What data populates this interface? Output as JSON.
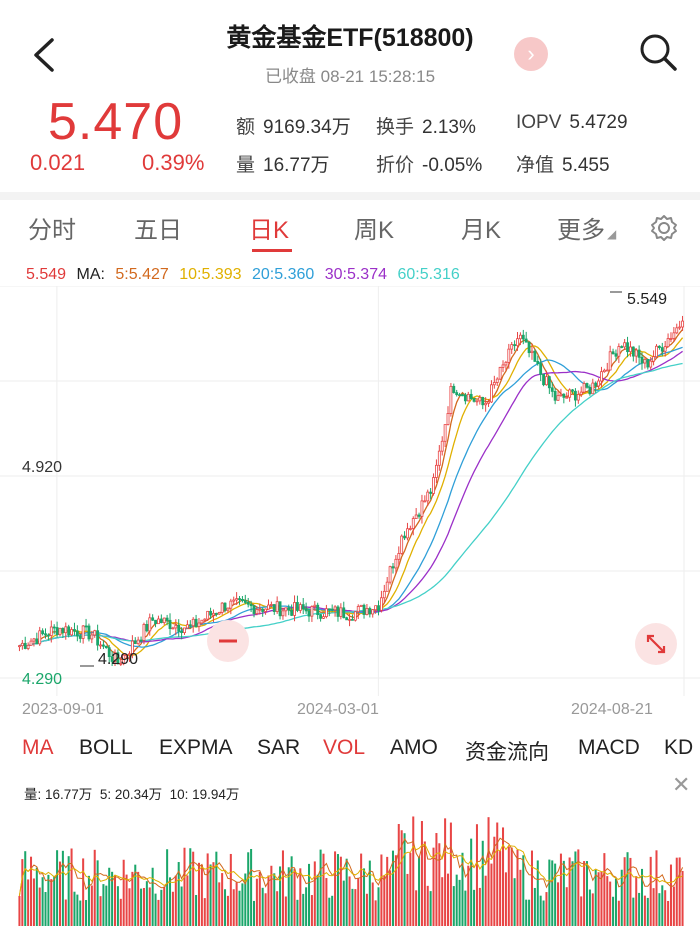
{
  "header": {
    "title": "黄金基金ETF(518800)",
    "status": "已收盘 08-21 15:28:15"
  },
  "quote": {
    "price": "5.470",
    "change": "0.021",
    "change_pct": "0.39%",
    "stats": [
      {
        "label": "额",
        "value": "9169.34万"
      },
      {
        "label": "换手",
        "value": "2.13%"
      },
      {
        "label": "IOPV",
        "value": "5.4729"
      },
      {
        "label": "量",
        "value": "16.77万"
      },
      {
        "label": "折价",
        "value": "-0.05%"
      },
      {
        "label": "净值",
        "value": "5.455"
      }
    ]
  },
  "tabs": [
    "分时",
    "五日",
    "日K",
    "周K",
    "月K",
    "更多"
  ],
  "active_tab": "日K",
  "ma_legend": {
    "high": "5.549",
    "prefix": "MA:",
    "items": [
      {
        "text": "5:5.427",
        "color": "#d2691e"
      },
      {
        "text": "10:5.393",
        "color": "#e0b000"
      },
      {
        "text": "20:5.360",
        "color": "#2f9fd8"
      },
      {
        "text": "30:5.374",
        "color": "#9b30c8"
      },
      {
        "text": "60:5.316",
        "color": "#44d0c8"
      }
    ]
  },
  "price_axis": {
    "top": "5.549",
    "mid": "4.920",
    "bottom": "4.290"
  },
  "annotations": {
    "max_label": "5.549",
    "min_label": "4.290"
  },
  "dates": [
    "2023-09-01",
    "2024-03-01",
    "2024-08-21"
  ],
  "indicators": [
    "MA",
    "BOLL",
    "EXPMA",
    "SAR",
    "VOL",
    "AMO",
    "资金流向",
    "MACD",
    "KD"
  ],
  "indicators_active": [
    "MA",
    "VOL"
  ],
  "volume_legend": {
    "vol": "量: 16.77万",
    "ma5": "5: 20.34万",
    "ma10": "10: 19.94万"
  },
  "colors": {
    "up": "#e84545",
    "down": "#1aa66a",
    "ma5": "#d2691e",
    "ma10": "#e0b000",
    "ma20": "#2f9fd8",
    "ma30": "#9b30c8",
    "ma60": "#44d0c8"
  },
  "chart_data": {
    "type": "candlestick",
    "title": "",
    "x_range": [
      "2023-08",
      "2024-08-21"
    ],
    "y_range": [
      4.29,
      5.549
    ],
    "y_ticks": [
      5.549,
      4.92,
      4.29
    ],
    "x_ticks": [
      "2023-09-01",
      "2024-03-01",
      "2024-08-21"
    ],
    "max": {
      "label": "5.549",
      "value": 5.549
    },
    "min": {
      "label": "4.290",
      "value": 4.29
    },
    "trend_points": [
      {
        "date": "2023-08-10",
        "close": 4.36
      },
      {
        "date": "2023-09-01",
        "close": 4.42
      },
      {
        "date": "2023-09-20",
        "close": 4.4
      },
      {
        "date": "2023-10-05",
        "close": 4.3
      },
      {
        "date": "2023-10-25",
        "close": 4.45
      },
      {
        "date": "2023-11-15",
        "close": 4.42
      },
      {
        "date": "2023-12-05",
        "close": 4.5
      },
      {
        "date": "2023-12-28",
        "close": 4.49
      },
      {
        "date": "2024-01-20",
        "close": 4.48
      },
      {
        "date": "2024-02-15",
        "close": 4.47
      },
      {
        "date": "2024-03-01",
        "close": 4.5
      },
      {
        "date": "2024-03-15",
        "close": 4.74
      },
      {
        "date": "2024-04-01",
        "close": 4.9
      },
      {
        "date": "2024-04-12",
        "close": 5.25
      },
      {
        "date": "2024-04-30",
        "close": 5.18
      },
      {
        "date": "2024-05-20",
        "close": 5.42
      },
      {
        "date": "2024-06-10",
        "close": 5.2
      },
      {
        "date": "2024-06-30",
        "close": 5.24
      },
      {
        "date": "2024-07-17",
        "close": 5.4
      },
      {
        "date": "2024-07-31",
        "close": 5.32
      },
      {
        "date": "2024-08-21",
        "close": 5.47
      }
    ],
    "volume": {
      "last": "16.77万",
      "ma5": "20.34万",
      "ma10": "19.94万"
    }
  }
}
